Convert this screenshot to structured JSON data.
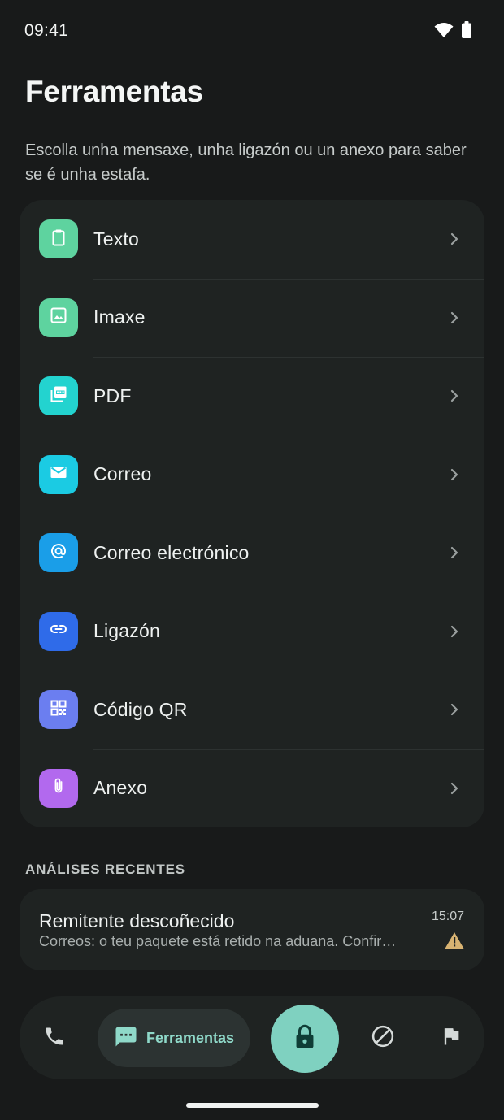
{
  "status_bar": {
    "time": "09:41"
  },
  "page": {
    "title": "Ferramentas",
    "subtitle": "Escolla unha mensaxe, unha ligazón ou un anexo para saber se é unha estafa."
  },
  "tools": [
    {
      "label": "Texto",
      "icon": "clipboard-icon",
      "color": "#5ed39f"
    },
    {
      "label": "Imaxe",
      "icon": "image-icon",
      "color": "#5ed39f"
    },
    {
      "label": "PDF",
      "icon": "pdf-icon",
      "color": "#23d3cf"
    },
    {
      "label": "Correo",
      "icon": "mail-icon",
      "color": "#1bcbe3"
    },
    {
      "label": "Correo electrónico",
      "icon": "at-sign-icon",
      "color": "#1a9ee8"
    },
    {
      "label": "Ligazón",
      "icon": "link-icon",
      "color": "#2f6be9"
    },
    {
      "label": "Código QR",
      "icon": "qr-code-icon",
      "color": "#6b7ef0"
    },
    {
      "label": "Anexo",
      "icon": "paperclip-icon",
      "color": "#b269ee"
    }
  ],
  "recent": {
    "section_title": "ANÁLISES RECENTES",
    "items": [
      {
        "sender": "Remitente descoñecido",
        "preview": "Correos: o teu paquete está retido na aduana. Confirma o pagamento para a entrega",
        "time": "15:07",
        "status_icon": "warning-icon",
        "status_color": "#d8b372"
      }
    ]
  },
  "bottom_nav": {
    "items": [
      {
        "icon": "phone-icon"
      },
      {
        "label": "Ferramentas",
        "icon": "chat-icon",
        "active": true
      },
      {
        "icon": "lock-icon",
        "primary": true
      },
      {
        "icon": "block-icon"
      },
      {
        "icon": "flag-icon"
      }
    ]
  },
  "colors": {
    "background": "#181a1a",
    "card": "#1f2322",
    "accent": "#7fd1c0",
    "accent_text": "#8fd9c9"
  }
}
